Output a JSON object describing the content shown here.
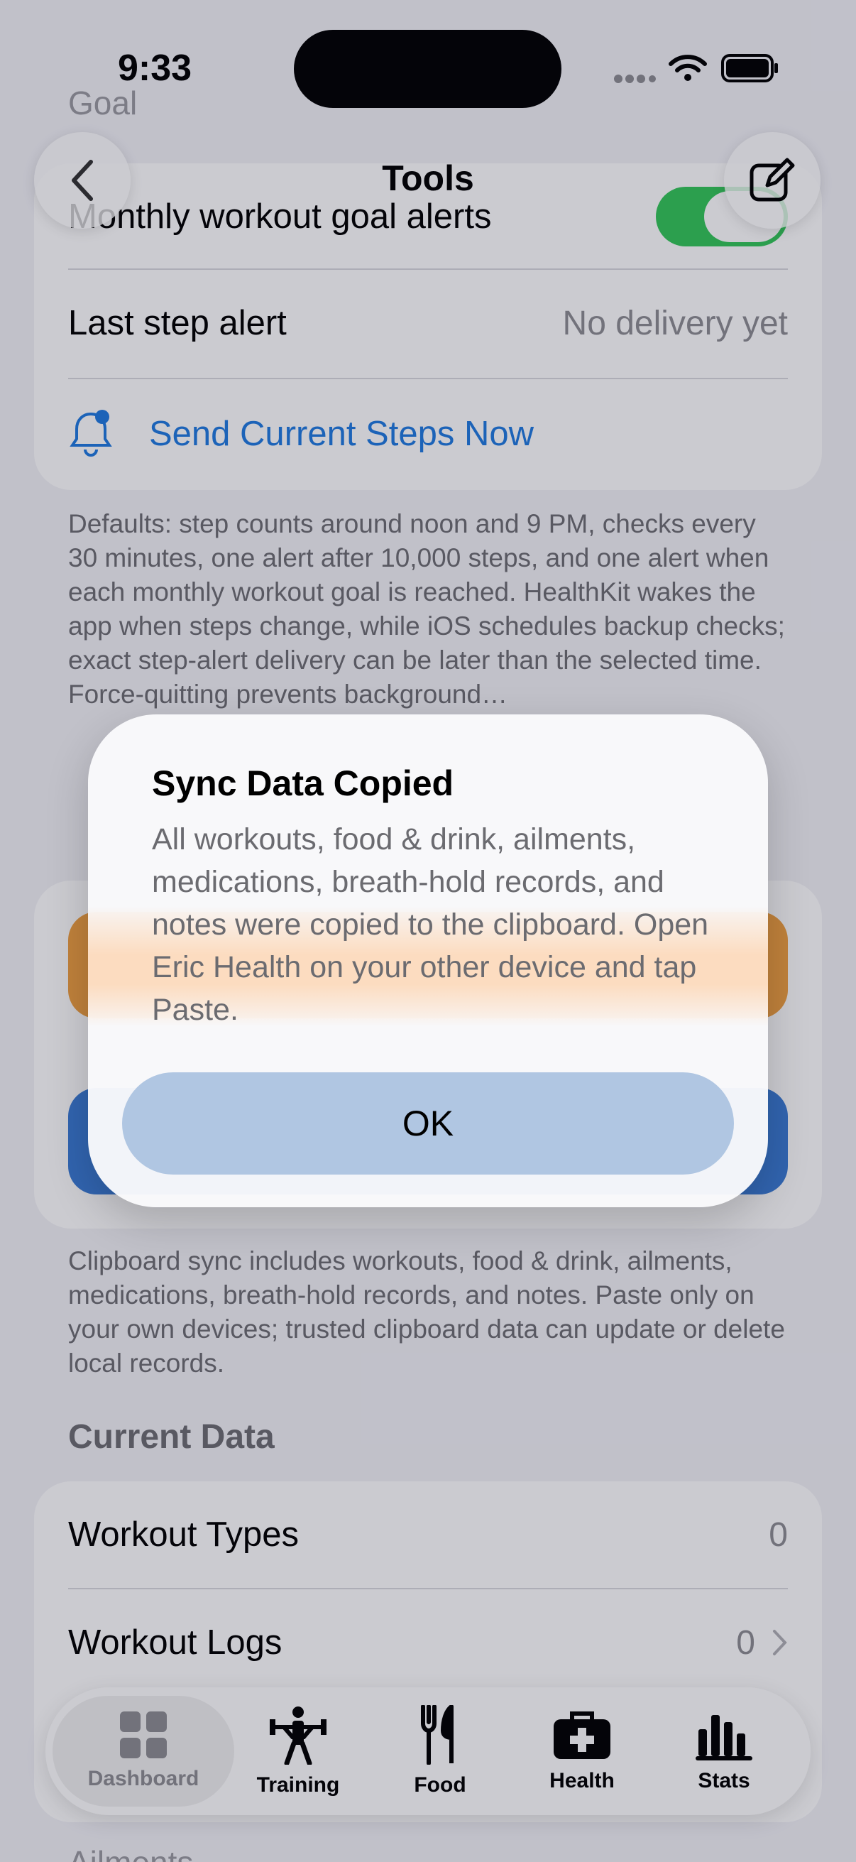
{
  "status_bar": {
    "time": "9:33"
  },
  "nav": {
    "title": "Tools"
  },
  "alerts_card": {
    "partial_top": "Goal",
    "monthly_label": "Monthly workout goal alerts",
    "last_step_label": "Last step alert",
    "last_step_value": "No delivery yet",
    "send_label": "Send Current Steps Now"
  },
  "defaults_note": "Defaults: step counts around noon and 9 PM, checks every 30 minutes, one alert after 10,000 steps, and one alert when each monthly workout goal is reached. HealthKit wakes the app when steps change, while iOS schedules backup checks; exact step-alert delivery can be later than the selected time. Force-quitting prevents background…",
  "clipboard_note": "Clipboard sync includes workouts, food & drink, ailments, medications, breath-hold records, and notes. Paste only on your own devices; trusted clipboard data can update or delete local records.",
  "current_data": {
    "header": "Current Data",
    "rows": [
      {
        "label": "Workout Types",
        "value": "0"
      },
      {
        "label": "Workout Logs",
        "value": "0"
      }
    ],
    "partial_bottom": "Ailments"
  },
  "alert": {
    "title": "Sync Data Copied",
    "message": "All workouts, food & drink, ailments, medications, breath-hold records, and notes were copied to the clipboard. Open Eric Health on your other device and tap Paste.",
    "ok_label": "OK"
  },
  "tabs": [
    {
      "label": "Dashboard",
      "icon": "grid-icon",
      "active": true
    },
    {
      "label": "Training",
      "icon": "weightlifter-icon",
      "active": false
    },
    {
      "label": "Food",
      "icon": "fork-knife-icon",
      "active": false
    },
    {
      "label": "Health",
      "icon": "medkit-icon",
      "active": false
    },
    {
      "label": "Stats",
      "icon": "bar-chart-icon",
      "active": false
    }
  ],
  "colors": {
    "accent": "#1f7ae0",
    "toggle_on": "#34c759",
    "orange_button": "#f0a040",
    "blue_button": "#3a7bd5"
  }
}
